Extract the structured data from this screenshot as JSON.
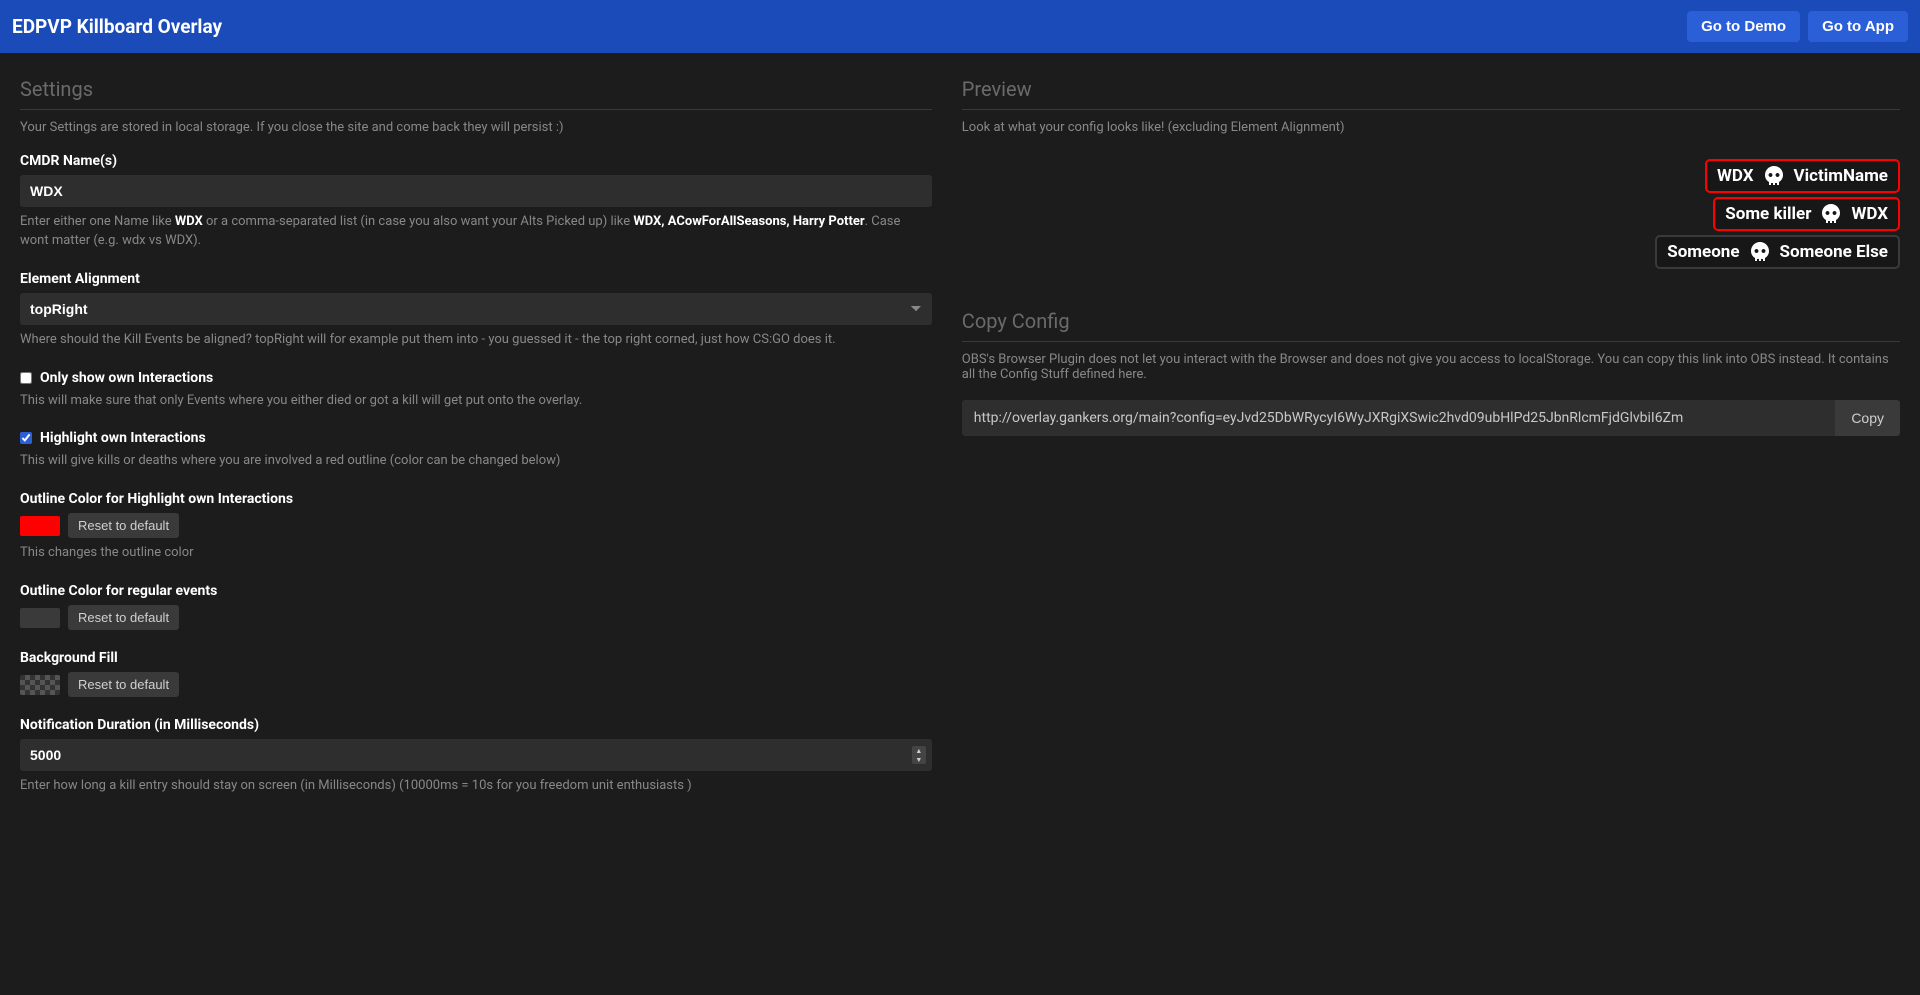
{
  "header": {
    "title": "EDPVP Killboard Overlay",
    "demo_btn": "Go to Demo",
    "app_btn": "Go to App"
  },
  "settings": {
    "title": "Settings",
    "subtitle": "Your Settings are stored in local storage. If you close the site and come back they will persist :)",
    "cmdr": {
      "label": "CMDR Name(s)",
      "value": "WDX",
      "help_pre": "Enter either one Name like ",
      "help_1": "WDX",
      "help_mid": " or a comma-separated list (in case you also want your Alts Picked up) like ",
      "help_2": "WDX, ACowForAllSeasons, Harry Potter",
      "help_post": ". Case wont matter (e.g. wdx vs WDX)."
    },
    "alignment": {
      "label": "Element Alignment",
      "value": "topRight",
      "help": "Where should the Kill Events be aligned? topRight will for example put them into - you guessed it - the top right corned, just how CS:GO does it."
    },
    "only_own": {
      "label": "Only show own Interactions",
      "checked": false,
      "help": "This will make sure that only Events where you either died or got a kill will get put onto the overlay."
    },
    "highlight": {
      "label": "Highlight own Interactions",
      "checked": true,
      "help": "This will give kills or deaths where you are involved a red outline (color can be changed below)"
    },
    "outline_highlight": {
      "label": "Outline Color for Highlight own Interactions",
      "color": "#ff0000",
      "reset": "Reset to default",
      "help": "This changes the outline color"
    },
    "outline_regular": {
      "label": "Outline Color for regular events",
      "color": "#3a3a3a",
      "reset": "Reset to default"
    },
    "bg_fill": {
      "label": "Background Fill",
      "reset": "Reset to default"
    },
    "duration": {
      "label": "Notification Duration (in Milliseconds)",
      "value": "5000",
      "help": "Enter how long a kill entry should stay on screen (in Milliseconds) (10000ms = 10s for you freedom unit enthusiasts )"
    }
  },
  "preview": {
    "title": "Preview",
    "subtitle": "Look at what your config looks like! (excluding Element Alignment)",
    "events": [
      {
        "killer": "WDX",
        "victim": "VictimName",
        "highlighted": true
      },
      {
        "killer": "Some killer",
        "victim": "WDX",
        "highlighted": true
      },
      {
        "killer": "Someone",
        "victim": "Someone Else",
        "highlighted": false
      }
    ]
  },
  "copy": {
    "title": "Copy Config",
    "subtitle": "OBS's Browser Plugin does not let you interact with the Browser and does not give you access to localStorage. You can copy this link into OBS instead. It contains all the Config Stuff defined here.",
    "url": "http://overlay.gankers.org/main?config=eyJvd25DbWRycyI6WyJXRgiXSwic2hvd09ubHlPd25JbnRlcmFjdGlvbiI6Zm",
    "btn": "Copy"
  }
}
